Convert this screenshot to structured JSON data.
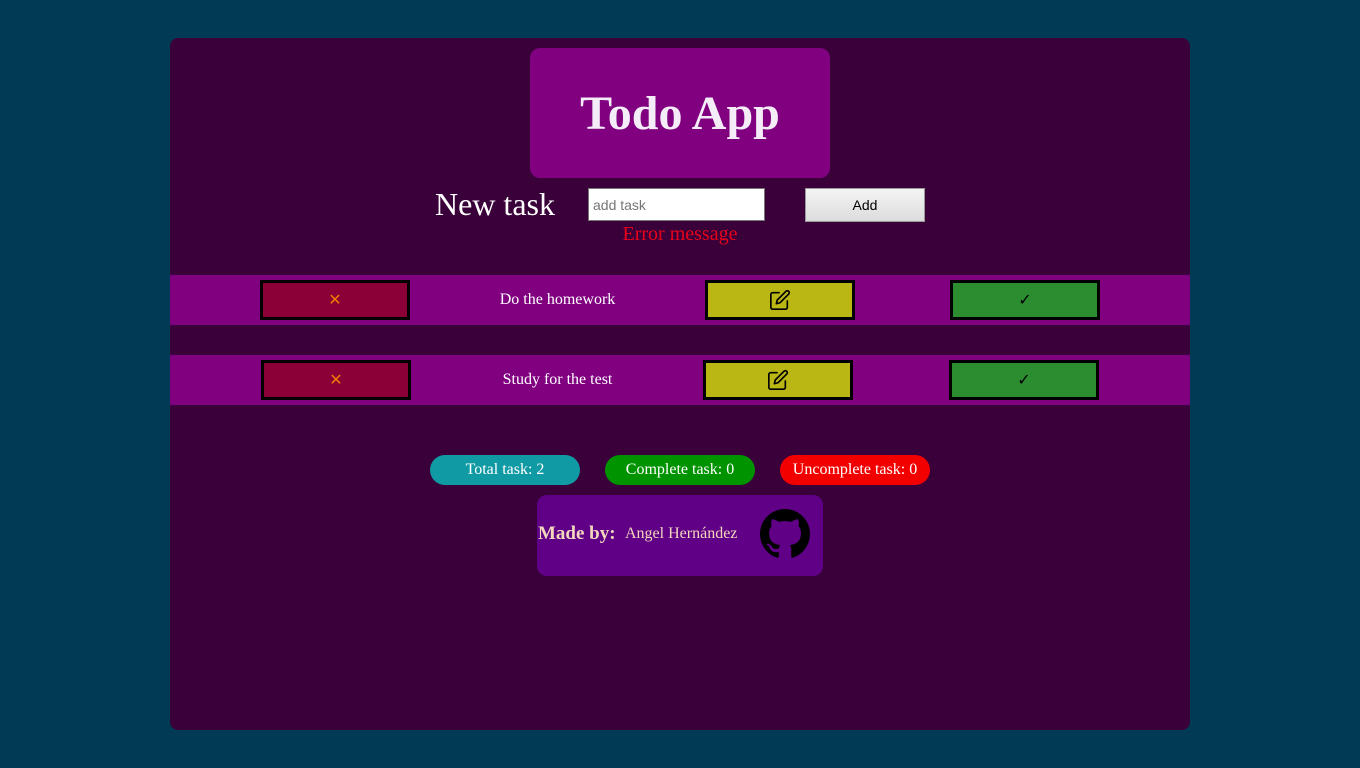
{
  "header": {
    "title": "Todo App"
  },
  "form": {
    "label": "New task",
    "input_placeholder": "add task",
    "input_value": "",
    "add_label": "Add",
    "error_message": "Error message"
  },
  "tasks": [
    {
      "text": "Do the homework",
      "delete_icon": "x-icon",
      "edit_icon": "pencil-square-icon",
      "complete_icon": "checkmark-icon"
    },
    {
      "text": "Study for the test",
      "delete_icon": "x-icon",
      "edit_icon": "pencil-square-icon",
      "complete_icon": "checkmark-icon"
    }
  ],
  "icons": {
    "delete_glyph": "✕",
    "complete_glyph": "✓"
  },
  "stats": {
    "total": "Total task: 2",
    "complete": "Complete task: 0",
    "uncomplete": "Uncomplete task: 0"
  },
  "footer": {
    "made_by_label": "Made by:",
    "author": "Angel Hernández",
    "link_icon": "github-icon"
  },
  "colors": {
    "page_background": "#003a55",
    "app_background": "#39003a",
    "title_background": "#800080",
    "task_row_background": "#800080",
    "delete_button": "#8b0036",
    "edit_button": "#bab715",
    "complete_button": "#2b8c30",
    "total_badge": "#0f9aa4",
    "complete_badge": "#009300",
    "uncomplete_badge": "#f20000",
    "error_text": "#e8001a",
    "footer_background": "#5f0086"
  }
}
